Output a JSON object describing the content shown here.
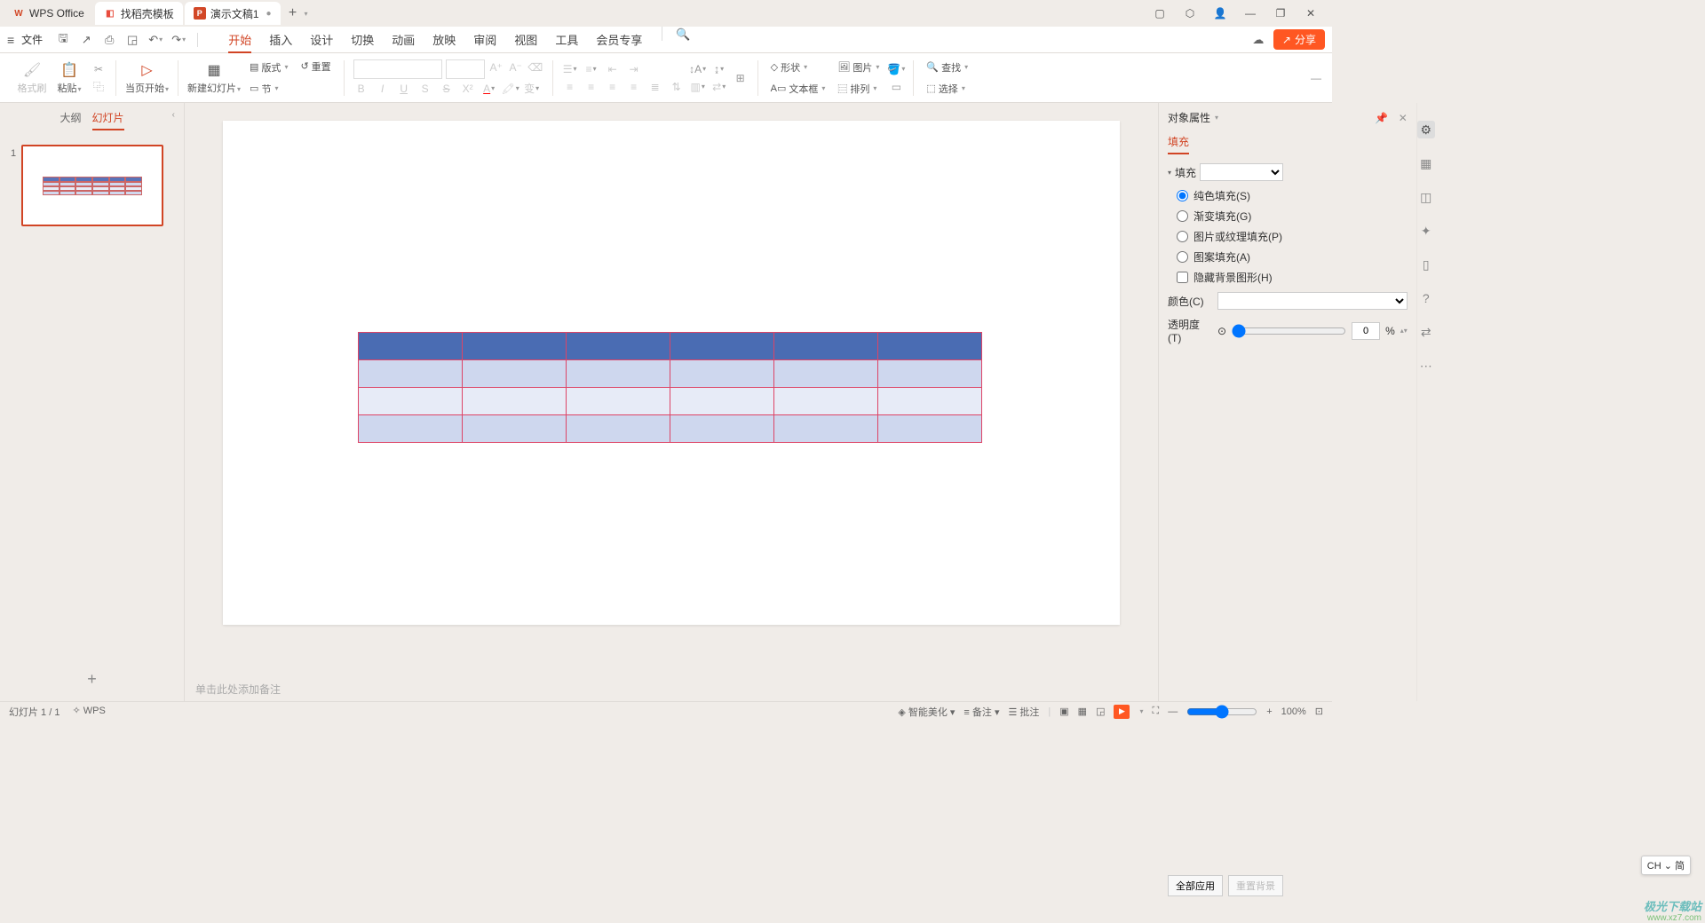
{
  "title_bar": {
    "app": "WPS Office",
    "template_tab": "找稻壳模板",
    "doc_tab": "演示文稿1"
  },
  "menu": {
    "file": "文件",
    "tabs": [
      "开始",
      "插入",
      "设计",
      "切换",
      "动画",
      "放映",
      "审阅",
      "视图",
      "工具",
      "会员专享"
    ],
    "active": 0,
    "share": "分享"
  },
  "ribbon": {
    "format_painter": "格式刷",
    "paste": "粘贴",
    "start_current": "当页开始",
    "new_slide": "新建幻灯片",
    "layout": "版式",
    "reset": "重置",
    "section": "节",
    "shape": "形状",
    "picture": "图片",
    "textbox": "文本框",
    "arrange": "排列",
    "find": "查找",
    "select": "选择"
  },
  "slide_panel": {
    "outline": "大纲",
    "slides": "幻灯片",
    "thumb_number": "1"
  },
  "notes": {
    "placeholder": "单击此处添加备注"
  },
  "props": {
    "title": "对象属性",
    "tab": "填充",
    "section": "填充",
    "fill_solid": "纯色填充(S)",
    "fill_gradient": "渐变填充(G)",
    "fill_picture": "图片或纹理填充(P)",
    "fill_pattern": "图案填充(A)",
    "hide_bg": "隐藏背景图形(H)",
    "color_label": "颜色(C)",
    "opacity_label": "透明度(T)",
    "opacity_value": "0",
    "opacity_unit": "%",
    "apply_all": "全部应用",
    "reset_bg": "重置背景"
  },
  "status": {
    "slide_counter": "幻灯片 1 / 1",
    "copilot": "WPS",
    "beautify": "智能美化",
    "notes": "备注",
    "comments": "批注",
    "zoom": "100%"
  },
  "ime": "CH ⌄ 简",
  "watermark": {
    "line1": "极光下载站",
    "line2": "www.xz7.com"
  }
}
